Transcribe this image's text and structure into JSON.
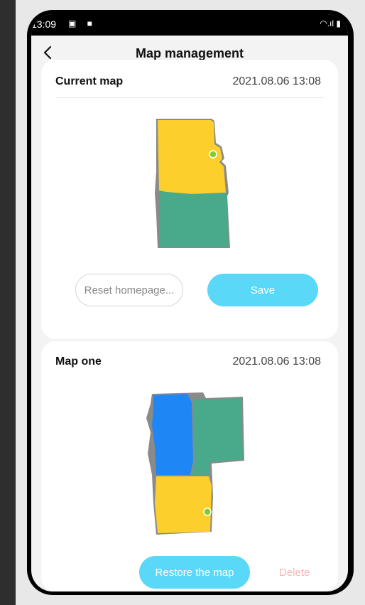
{
  "status": {
    "time": "13:09"
  },
  "header": {
    "title": "Map management"
  },
  "current_map": {
    "name": "Current map",
    "date": "2021.08.06 13:08",
    "reset_label": "Reset homepage...",
    "save_label": "Save"
  },
  "map_one": {
    "name": "Map one",
    "date": "2021.08.06 13:08",
    "restore_label": "Restore the map",
    "delete_label": "Delete"
  },
  "colors": {
    "accent": "#5ad8f8",
    "room_yellow": "#fccf2c",
    "room_green": "#48a98b",
    "room_blue": "#1f86f6",
    "wall": "#8a8a8a",
    "delete": "#f8b7b7"
  }
}
